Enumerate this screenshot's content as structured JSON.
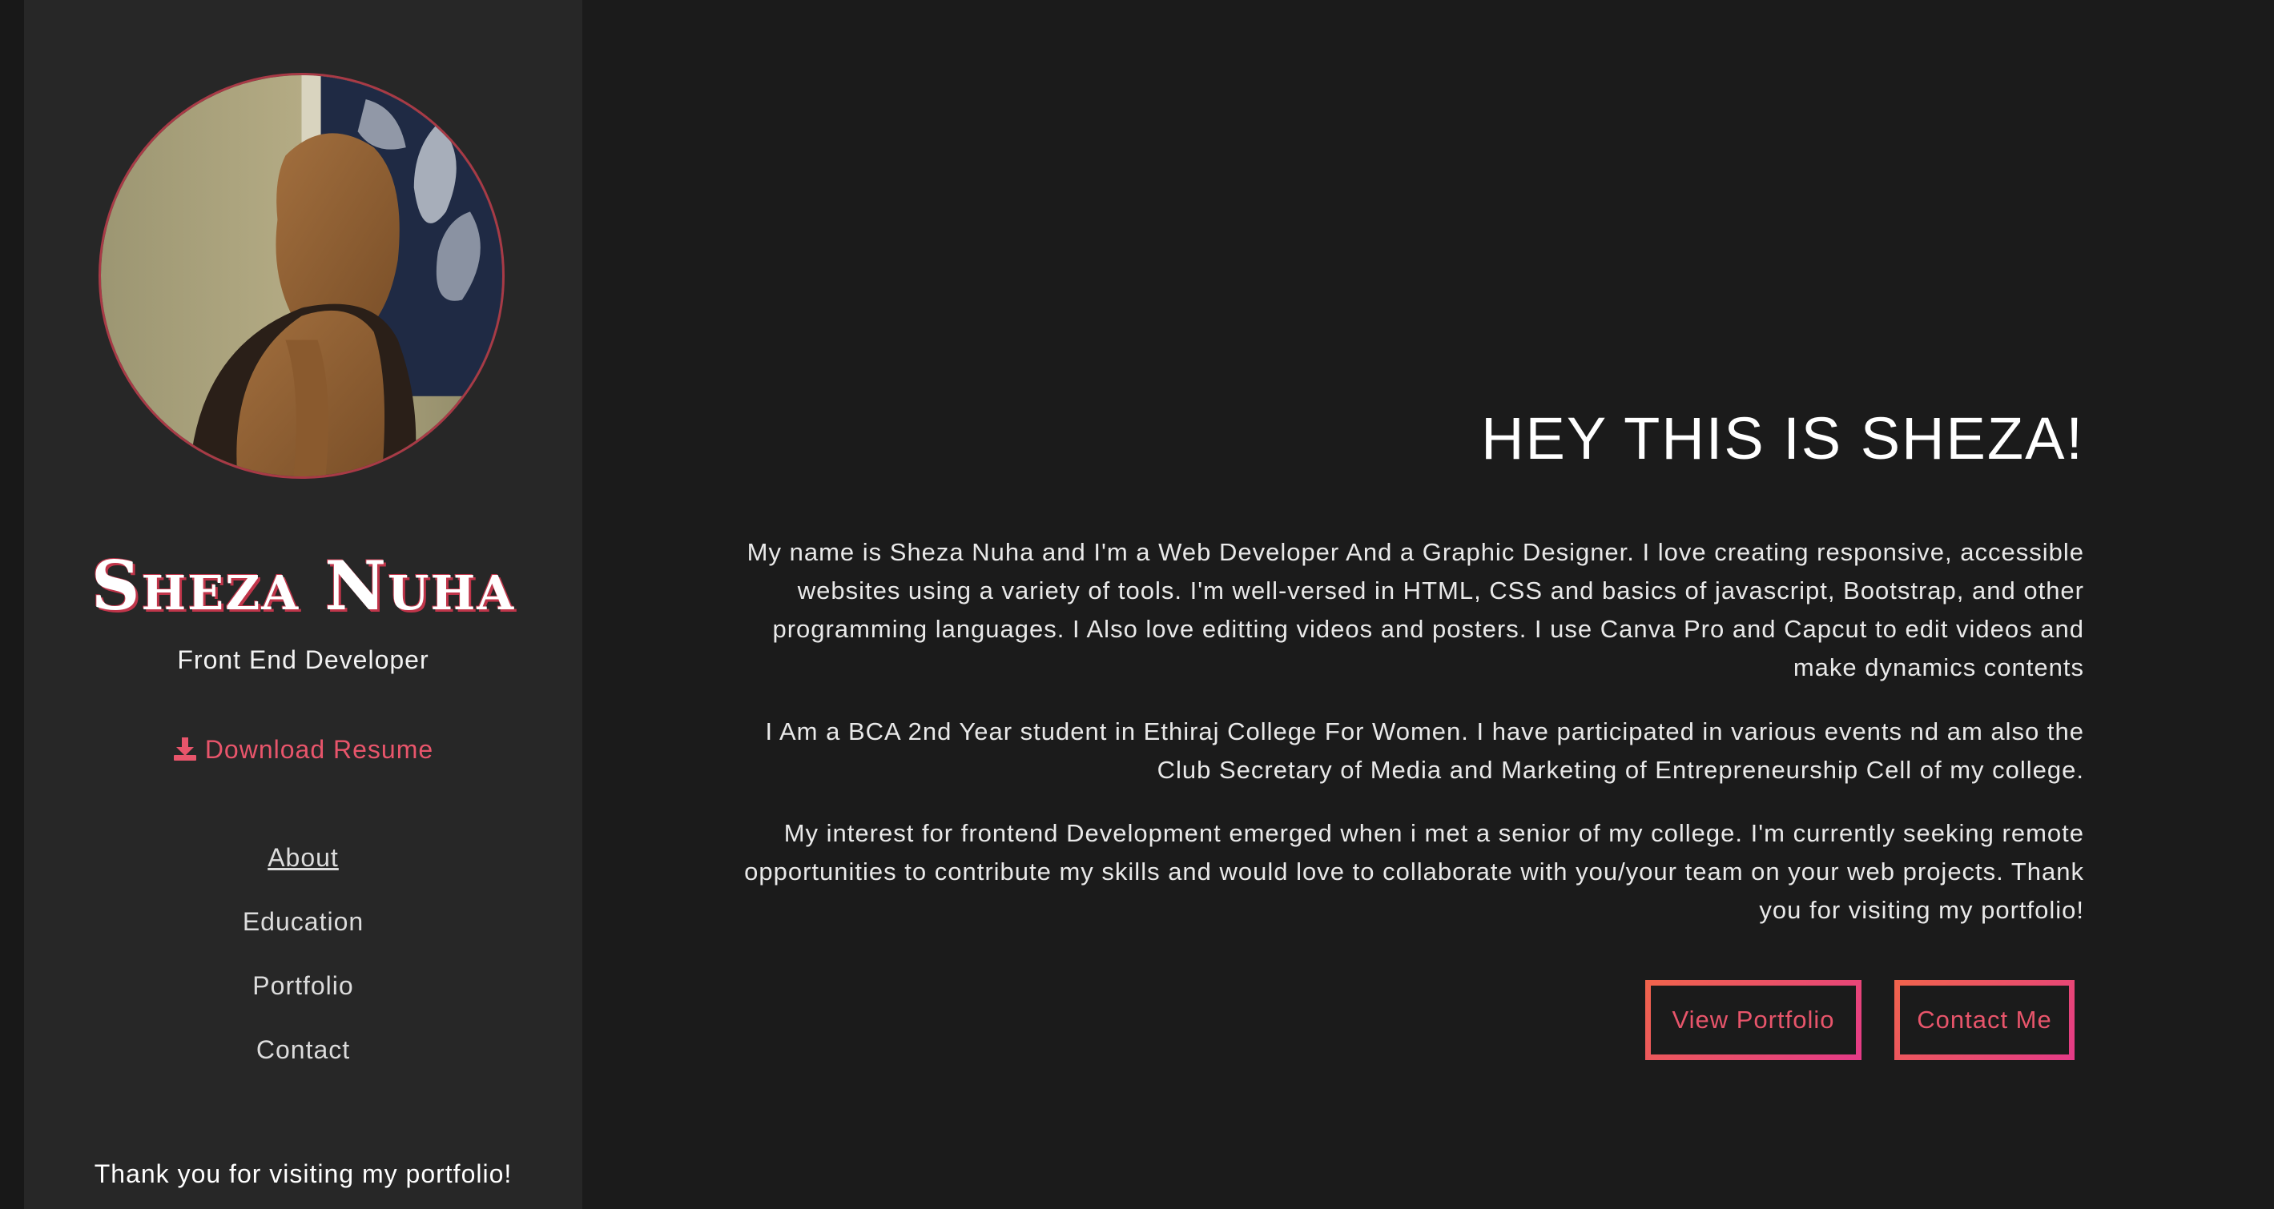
{
  "sidebar": {
    "name": "Sheza Nuha",
    "role": "Front End Developer",
    "download_label": "Download Resume",
    "nav": [
      {
        "label": "About"
      },
      {
        "label": "Education"
      },
      {
        "label": "Portfolio"
      },
      {
        "label": "Contact"
      }
    ],
    "footer_note": "Thank you for visiting my portfolio!"
  },
  "main": {
    "headline": "HEY THIS IS SHEZA!",
    "paragraphs": [
      "My name is Sheza Nuha and I'm a Web Developer And a Graphic Designer. I love creating responsive, accessible websites using a variety of tools. I'm well-versed in HTML, CSS and basics of javascript, Bootstrap, and other programming languages. I Also love editting videos and posters. I use Canva Pro and Capcut to edit videos and make dynamics contents",
      "I Am a BCA 2nd Year student in Ethiraj College For Women. I have participated in various events nd am also the Club Secretary of Media and Marketing of Entrepreneurship Cell of my college.",
      "My interest for frontend Development emerged when i met a senior of my college. I'm currently seeking remote opportunities to contribute my skills and would love to collaborate with you/your team on your web projects. Thank you for visiting my portfolio!"
    ],
    "buttons": {
      "view_portfolio": "View Portfolio",
      "contact_me": "Contact Me"
    }
  },
  "icons": {
    "download": "download-icon"
  },
  "colors": {
    "accent": "#e8556b",
    "gradient_start": "#f0644b",
    "gradient_end": "#e43a88",
    "background": "#1b1b1b",
    "sidebar": "#272727"
  }
}
